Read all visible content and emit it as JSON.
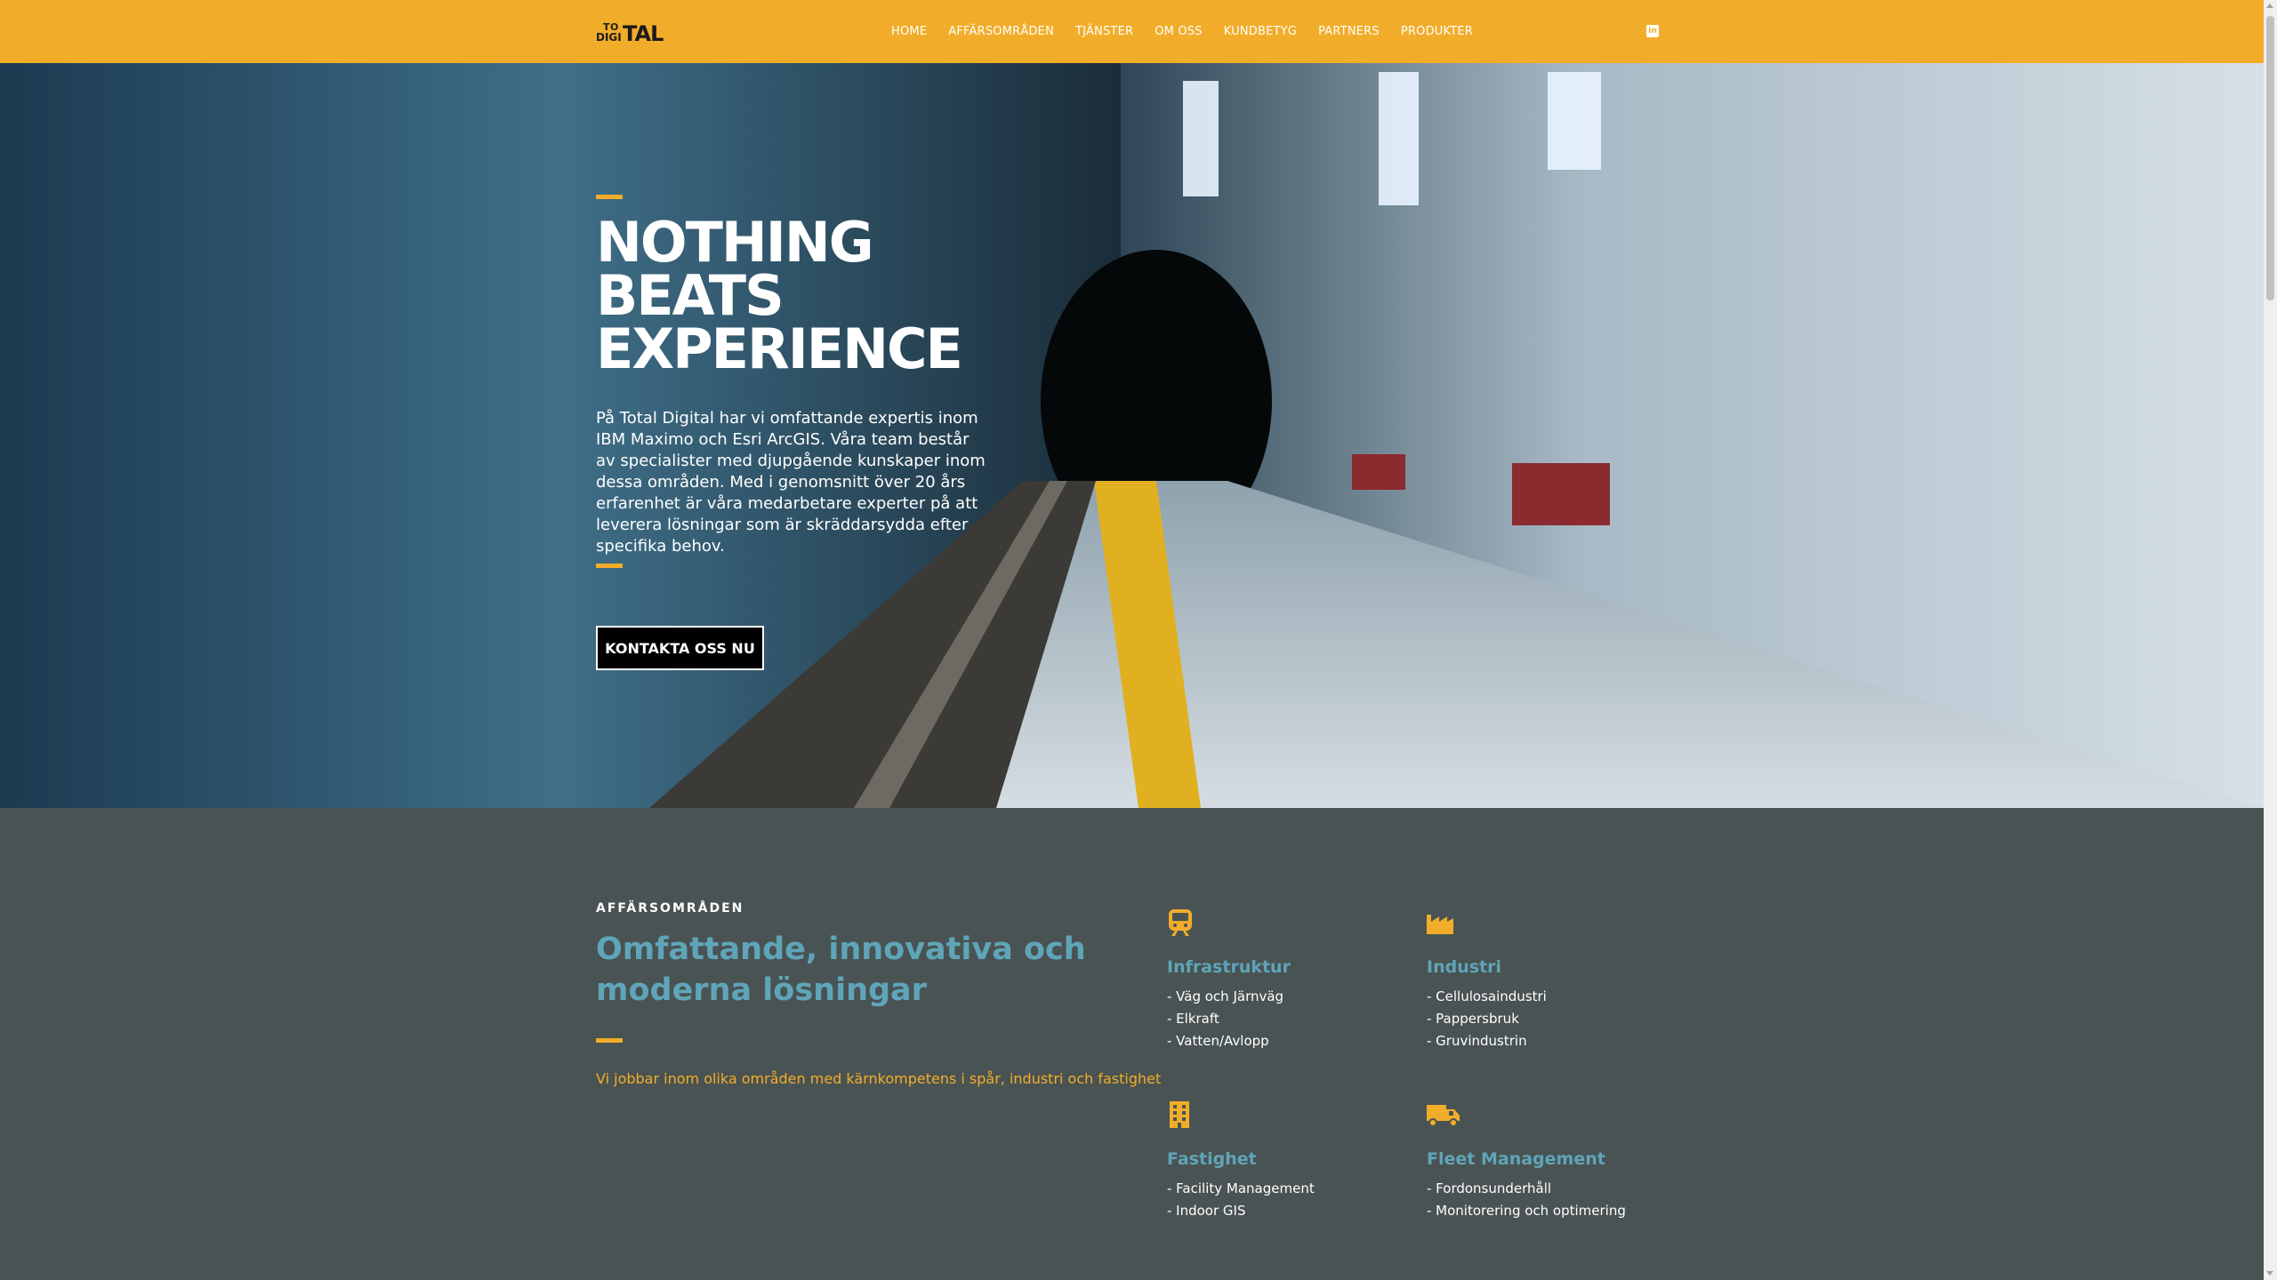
{
  "brand": {
    "logo_text": "TOTAL DIGITAL"
  },
  "nav": {
    "items": [
      "HOME",
      "AFFÄRSOMRÅDEN",
      "TJÄNSTER",
      "OM OSS",
      "KUNDBETYG",
      "PARTNERS",
      "PRODUKTER"
    ],
    "social_icon": "linkedin-icon"
  },
  "hero": {
    "title_lines": [
      "NOTHING",
      "BEATS",
      "EXPERIENCE"
    ],
    "text": "På Total Digital har vi omfattande expertis inom IBM Maximo och Esri ArcGIS. Våra team består av specialister med djupgående kunskaper inom dessa områden. Med i genomsnitt över 20 års erfarenhet är våra medarbetare experter på att leverera lösningar som är skräddarsydda efter specifika behov.",
    "button_label": "KONTAKTA OSS NU",
    "image": "subway-station-platform"
  },
  "section": {
    "label": "AFFÄRSOMRÅDEN",
    "heading": "Omfattande, innovativa och moderna lösningar",
    "text": "Vi jobbar inom olika områden med kärnkompetens i spår, industri och fastighet",
    "areas": [
      {
        "icon": "train-icon",
        "title": "Infrastruktur",
        "items": [
          "- Väg och Järnväg",
          "- Elkraft",
          "- Vatten/Avlopp"
        ]
      },
      {
        "icon": "factory-icon",
        "title": "Industri",
        "items": [
          "- Cellulosaindustri",
          "- Pappersbruk",
          "- Gruvindustrin"
        ]
      },
      {
        "icon": "building-icon",
        "title": "Fastighet",
        "items": [
          "- Facility Management",
          "- Indoor GIS"
        ]
      },
      {
        "icon": "truck-icon",
        "title": "Fleet Management",
        "items": [
          "- Fordonsunderhåll",
          "- Monitorering och optimering"
        ]
      }
    ]
  },
  "colors": {
    "accent": "#f1ad2a",
    "heading_blue": "#5fa5b9",
    "section_bg": "#4a5353"
  }
}
